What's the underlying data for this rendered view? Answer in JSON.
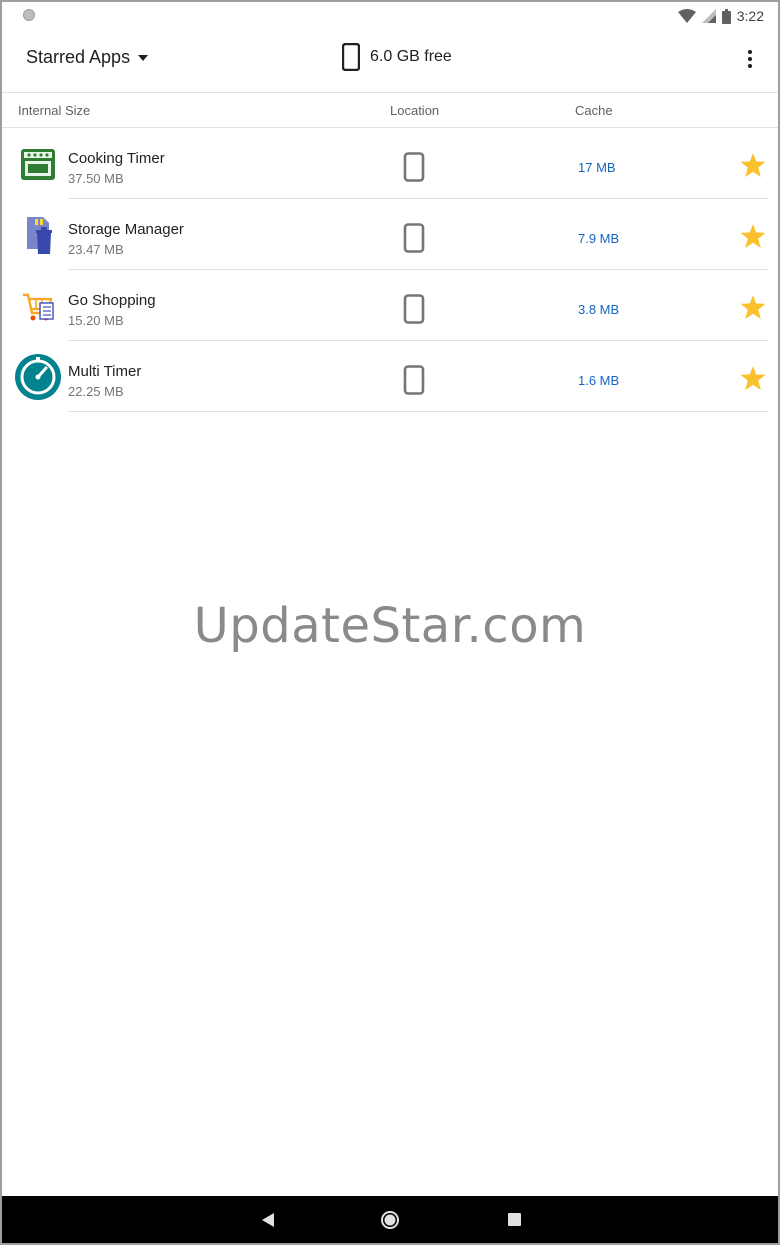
{
  "status_bar": {
    "time": "3:22"
  },
  "toolbar": {
    "filter_label": "Starred Apps",
    "free_space": "6.0 GB free"
  },
  "columns": {
    "internal_size": "Internal Size",
    "location": "Location",
    "cache": "Cache"
  },
  "apps": [
    {
      "name": "Cooking Timer",
      "size": "37.50 MB",
      "cache": "17 MB",
      "icon": "oven-icon",
      "starred": true
    },
    {
      "name": "Storage Manager",
      "size": "23.47 MB",
      "cache": "7.9 MB",
      "icon": "sd-card-trash-icon",
      "starred": true
    },
    {
      "name": "Go Shopping",
      "size": "15.20 MB",
      "cache": "3.8 MB",
      "icon": "shopping-cart-icon",
      "starred": true
    },
    {
      "name": "Multi Timer",
      "size": "22.25 MB",
      "cache": "1.6 MB",
      "icon": "stopwatch-icon",
      "starred": true
    }
  ],
  "watermark": "UpdateStar.com",
  "colors": {
    "accent_blue": "#1565c0",
    "star_yellow": "#fbc02d",
    "nav_bar": "#000000"
  }
}
